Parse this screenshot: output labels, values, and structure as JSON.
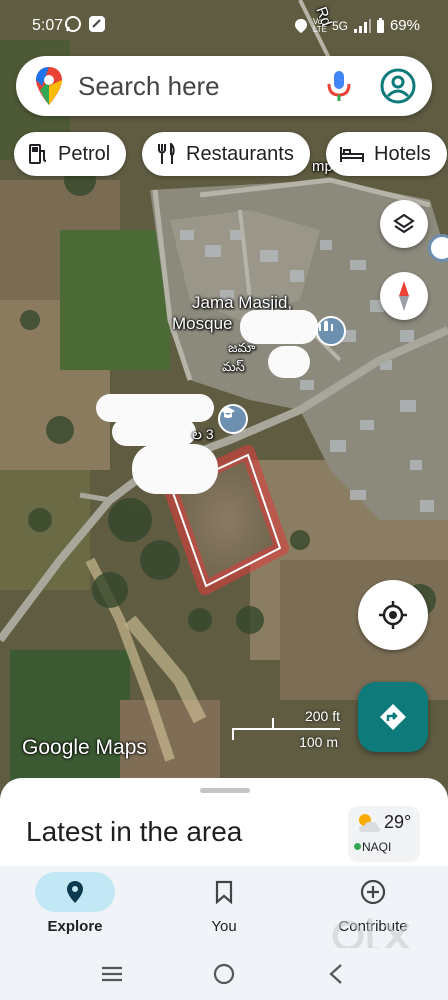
{
  "status_bar": {
    "time": "5:07",
    "network": "5G",
    "battery": "69%"
  },
  "search": {
    "placeholder": "Search here"
  },
  "chips": [
    {
      "label": "Petrol",
      "icon": "fuel-icon"
    },
    {
      "label": "Restaurants",
      "icon": "fork-knife-icon"
    },
    {
      "label": "Hotels",
      "icon": "bed-icon"
    }
  ],
  "map": {
    "labels": {
      "road": "Rd",
      "poi_name_line1": "Jama Masjid,",
      "poi_name_line2": "Mosque",
      "poi_local_line1": "జమా",
      "poi_local_line2": "మస్",
      "school_label": "ల 3",
      "partial_top": "mp"
    },
    "scale": {
      "feet": "200 ft",
      "meters": "100 m"
    },
    "logo": "Google Maps",
    "highlight_color": "#e23b3b"
  },
  "sheet": {
    "title": "Latest in the area",
    "weather": {
      "temp": "29°",
      "aqi": "NAQI"
    }
  },
  "nav": {
    "items": [
      {
        "label": "Explore",
        "icon": "location-pin-icon",
        "active": true
      },
      {
        "label": "You",
        "icon": "bookmark-icon",
        "active": false
      },
      {
        "label": "Contribute",
        "icon": "add-circle-icon",
        "active": false
      }
    ]
  },
  "colors": {
    "accent": "#0e7a7a",
    "active_pill": "#c2e7f5"
  }
}
